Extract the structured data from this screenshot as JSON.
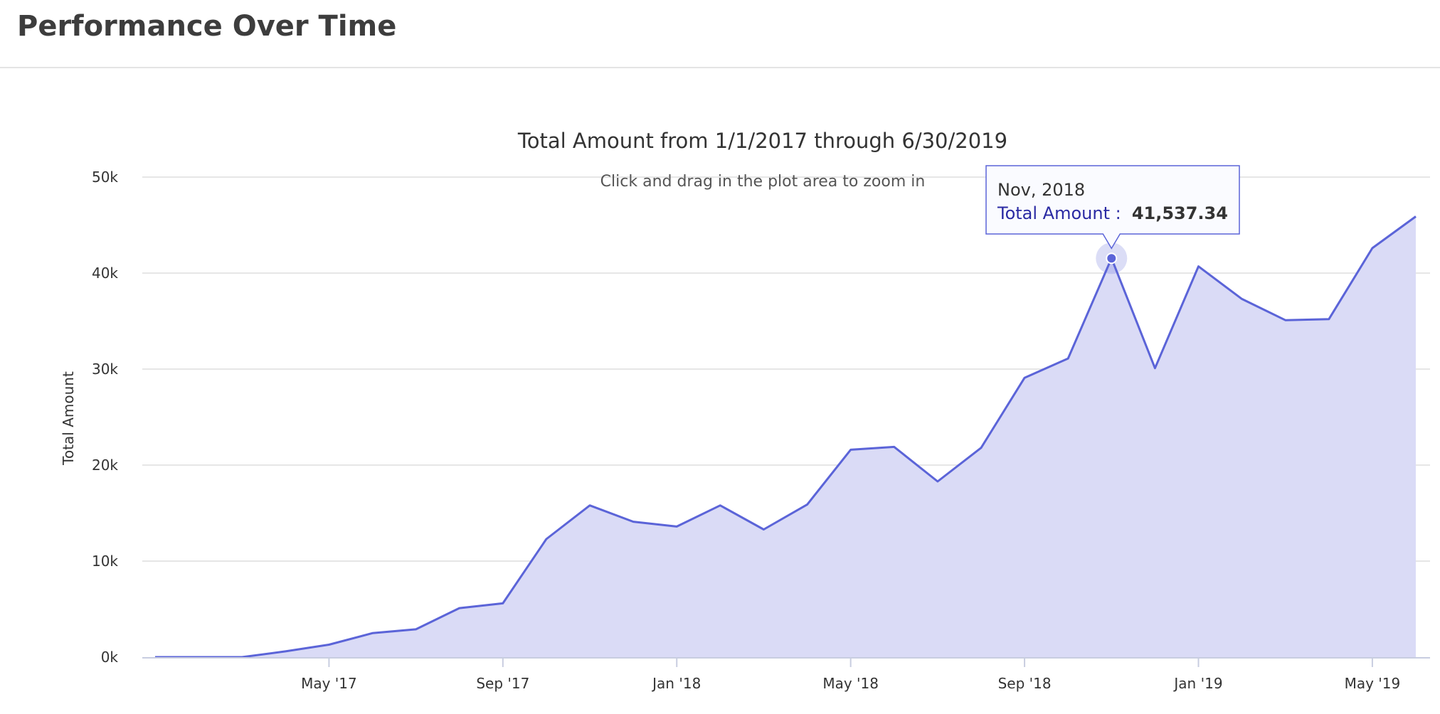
{
  "panel": {
    "title": "Performance Over Time"
  },
  "chart_data": {
    "type": "area",
    "title": "Total Amount from 1/1/2017 through 6/30/2019",
    "subtitle": "Click and drag in the plot area to zoom in",
    "ylabel": "Total Amount",
    "xlabel": "",
    "ylim": [
      0,
      50000
    ],
    "y_ticks": [
      {
        "value": 0,
        "label": "0k"
      },
      {
        "value": 10000,
        "label": "10k"
      },
      {
        "value": 20000,
        "label": "20k"
      },
      {
        "value": 30000,
        "label": "30k"
      },
      {
        "value": 40000,
        "label": "40k"
      },
      {
        "value": 50000,
        "label": "50k"
      }
    ],
    "x_ticks": [
      {
        "date": "2017-05",
        "label": "May '17"
      },
      {
        "date": "2017-09",
        "label": "Sep '17"
      },
      {
        "date": "2018-01",
        "label": "Jan '18"
      },
      {
        "date": "2018-05",
        "label": "May '18"
      },
      {
        "date": "2018-09",
        "label": "Sep '18"
      },
      {
        "date": "2019-01",
        "label": "Jan '19"
      },
      {
        "date": "2019-05",
        "label": "May '19"
      }
    ],
    "grid": true,
    "legend": "none",
    "colors": {
      "line": "#5b64d8",
      "fill": "#dadbf6",
      "grid": "#e6e6e6",
      "axis": "#c8cde0"
    },
    "series": [
      {
        "x": [
          "2017-01",
          "2017-02",
          "2017-03",
          "2017-04",
          "2017-05",
          "2017-06",
          "2017-07",
          "2017-08",
          "2017-09",
          "2017-10",
          "2017-11",
          "2017-12",
          "2018-01",
          "2018-02",
          "2018-03",
          "2018-04",
          "2018-05",
          "2018-06",
          "2018-07",
          "2018-08",
          "2018-09",
          "2018-10",
          "2018-11",
          "2018-12",
          "2019-01",
          "2019-02",
          "2019-03",
          "2019-04",
          "2019-05",
          "2019-06"
        ],
        "values": [
          0,
          0,
          0,
          600,
          1300,
          2500,
          2900,
          5100,
          5600,
          12300,
          15800,
          14100,
          13600,
          15800,
          13300,
          15900,
          21600,
          21900,
          18300,
          21800,
          29100,
          31100,
          41537.34,
          30100,
          40700,
          37300,
          35100,
          35200,
          42600,
          45900
        ]
      }
    ],
    "tooltip": {
      "date": "Nov, 2018",
      "series_label": "Total Amount :",
      "value": "41,537.34",
      "point_index": 22
    }
  }
}
